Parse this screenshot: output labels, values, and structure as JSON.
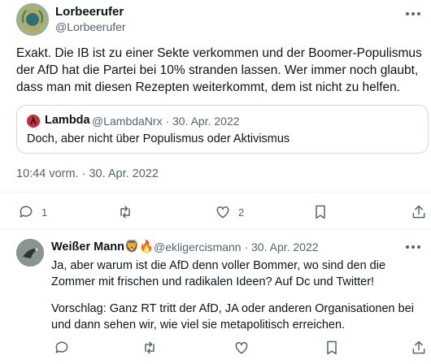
{
  "main_tweet": {
    "author_name": "Lorbeerufer",
    "author_handle": "@Lorbeerufer",
    "text": "Exakt. Die IB ist zu einer Sekte verkommen und der Boomer-Populismus der AfD hat die Partei bei 10% stranden lassen. Wer immer noch glaubt, dass man mit diesen Rezepten weiterkommt, dem ist nicht zu helfen.",
    "timestamp": "10:44 vorm. · 30. Apr. 2022",
    "quote": {
      "author_name": "Lambda",
      "author_handle_date": "@LambdaNrx · 30. Apr. 2022",
      "text": "Doch, aber nicht über Populismus oder Aktivismus"
    },
    "actions": {
      "reply_count": "1",
      "like_count": "2"
    }
  },
  "reply_tweet": {
    "author_name": "Weißer Mann🦁🔥",
    "author_handle_date": "@ekligercismann · 30. Apr. 2022",
    "text_p1": "Ja, aber warum ist die AfD denn voller Bommer, wo sind den die Zommer mit frischen und radikalen Ideen? Auf Dc und Twitter!",
    "text_p2": "Vorschlag: Ganz RT tritt der AfD, JA oder anderen Organisationen bei und dann sehen wir, wie viel sie metapolitisch erreichen."
  },
  "icons": [
    "laurel-avatar",
    "reply-icon",
    "retweet-icon",
    "like-icon",
    "bookmark-icon",
    "share-icon",
    "more-icon"
  ]
}
